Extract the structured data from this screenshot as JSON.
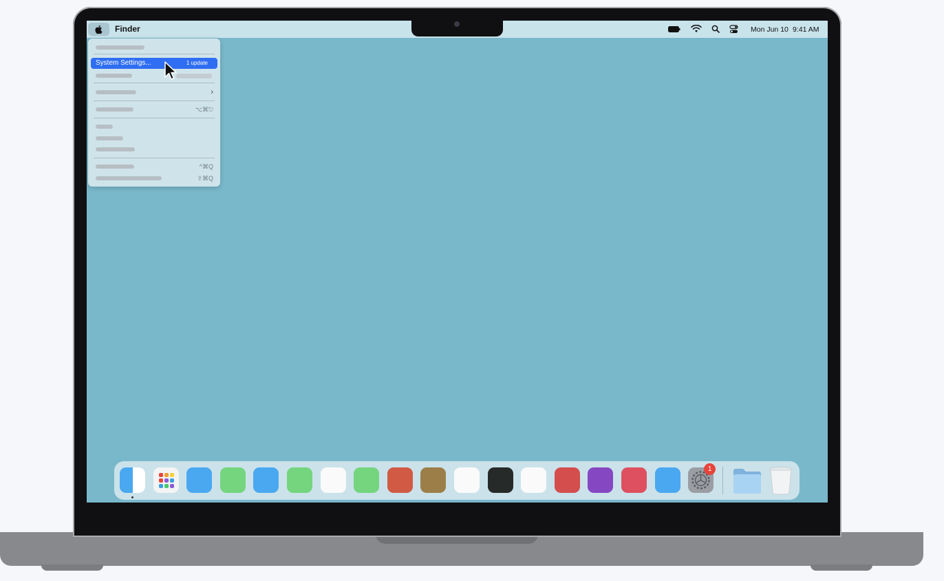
{
  "menubar": {
    "app_name": "Finder",
    "date": "Mon Jun 10",
    "time": "9:41 AM",
    "icons": [
      "apple-icon",
      "battery-icon",
      "wifi-icon",
      "search-icon",
      "control-center-icon"
    ]
  },
  "apple_menu": {
    "highlighted_item": "System Settings...",
    "update_badge": "1 update",
    "shortcuts": {
      "force_quit": "⌥⌘⎋",
      "lock_screen": "^⌘Q",
      "log_out": "⇧⌘Q"
    }
  },
  "dock": {
    "apps": [
      {
        "icon": "finder-icon",
        "color": "#4aa8f0"
      },
      {
        "icon": "launchpad-icon",
        "color": "#f4f4f4"
      },
      {
        "icon": "app-icon",
        "color": "#4aa8f0"
      },
      {
        "icon": "app-icon",
        "color": "#74d57e"
      },
      {
        "icon": "app-icon",
        "color": "#4aa8f0"
      },
      {
        "icon": "app-icon",
        "color": "#74d57e"
      },
      {
        "icon": "app-icon",
        "color": "#fafafa"
      },
      {
        "icon": "app-icon",
        "color": "#74d57e"
      },
      {
        "icon": "app-icon",
        "color": "#d15a44"
      },
      {
        "icon": "app-icon",
        "color": "#9c7f48"
      },
      {
        "icon": "app-icon",
        "color": "#fafafa"
      },
      {
        "icon": "app-icon",
        "color": "#262a28"
      },
      {
        "icon": "app-icon",
        "color": "#fafafa"
      },
      {
        "icon": "app-icon",
        "color": "#d44e4e"
      },
      {
        "icon": "app-icon",
        "color": "#8547c2"
      },
      {
        "icon": "app-icon",
        "color": "#de5060"
      },
      {
        "icon": "app-icon",
        "color": "#4aa8f0"
      },
      {
        "icon": "system-settings-icon",
        "color": "#9a9ea3"
      }
    ],
    "settings_badge": "1",
    "folder_color": "#8cc1e8",
    "trash_icon": "trash-icon"
  }
}
